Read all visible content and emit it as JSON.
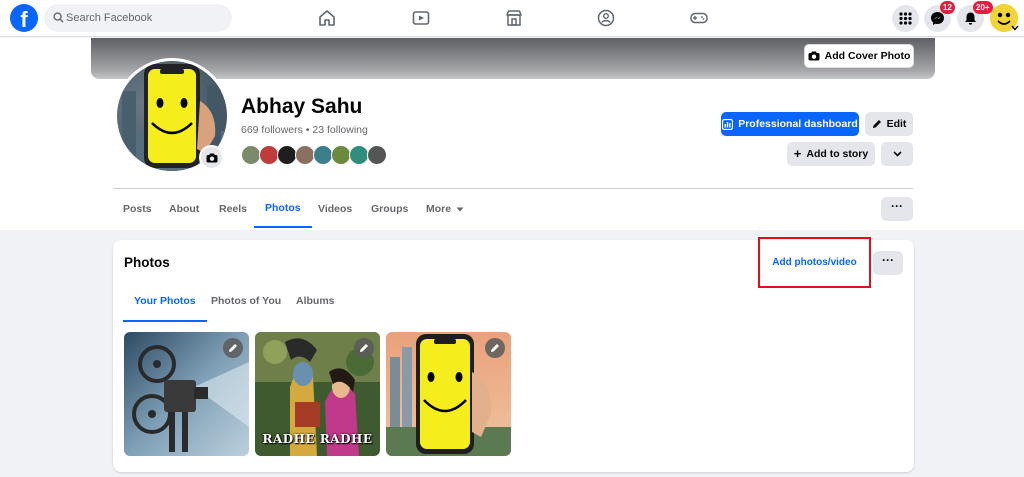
{
  "topbar": {
    "logo_letter": "f",
    "search_placeholder": "Search Facebook",
    "nav_icons": [
      "home-icon",
      "video-icon",
      "marketplace-icon",
      "groups-icon",
      "gaming-icon"
    ],
    "right_icons": [
      "menu-grid-icon",
      "messenger-icon",
      "notifications-icon"
    ],
    "messenger_badge": "12",
    "notifications_badge": "20+"
  },
  "profile": {
    "cover_button": "Add Cover Photo",
    "name": "Abhay Sahu",
    "follow_info": "669 followers • 23 following",
    "buttons": {
      "professional_dashboard": "Professional dashboard",
      "edit": "Edit",
      "add_to_story": "Add to story"
    },
    "tabs": [
      "Posts",
      "About",
      "Reels",
      "Photos",
      "Videos",
      "Groups",
      "More"
    ],
    "active_tab": "Photos"
  },
  "photos_card": {
    "title": "Photos",
    "add_button": "Add photos/video",
    "sub_tabs": [
      "Your Photos",
      "Photos of You",
      "Albums"
    ],
    "active_sub_tab": "Your Photos",
    "photos": [
      {
        "name": "film-projector-photo"
      },
      {
        "name": "radhe-radhe-photo",
        "caption": "RADHE RADHE"
      },
      {
        "name": "smiley-phone-photo"
      }
    ]
  },
  "colors": {
    "brand_blue": "#0866ff",
    "highlight_red": "#e0101f",
    "badge_red": "#e41e3f",
    "background": "#f0f2f5"
  }
}
